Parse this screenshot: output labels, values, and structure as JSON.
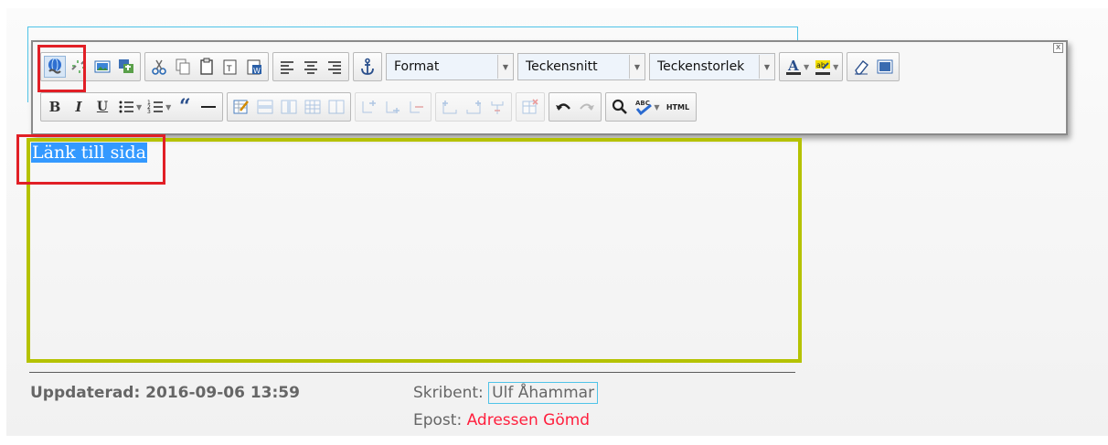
{
  "toolbar": {
    "format_label": "Format",
    "font_label": "Teckensnitt",
    "size_label": "Teckenstorlek",
    "html_label": "HTML",
    "close_label": "x",
    "row1_icons": [
      "insert-link-icon",
      "unlink-icon",
      "insert-image-icon",
      "insert-media-icon",
      "cut-icon",
      "copy-icon",
      "paste-icon",
      "paste-text-icon",
      "paste-word-icon",
      "align-left-icon",
      "align-center-icon",
      "align-right-icon",
      "anchor-icon"
    ],
    "row2_icons": [
      "bold-icon",
      "italic-icon",
      "underline-icon",
      "bullet-list-icon",
      "numbered-list-icon",
      "blockquote-icon",
      "horizontal-rule-icon",
      "edit-table-icon",
      "table-row-icon",
      "table-col-icon",
      "table-cells-icon",
      "table-merge-icon",
      "insert-row-before-icon",
      "insert-row-after-icon",
      "delete-row-icon",
      "insert-col-before-icon",
      "insert-col-after-icon",
      "delete-col-icon",
      "delete-table-icon",
      "undo-icon",
      "redo-icon",
      "search-icon",
      "spellcheck-icon"
    ]
  },
  "editor": {
    "content": "Länk till sida"
  },
  "footer": {
    "updated": "Uppdaterad: 2016-09-06 13:59",
    "author_label": "Skribent:",
    "author_name": "Ulf Åhammar",
    "email_label": "Epost:",
    "email_value": "Adressen Gömd"
  },
  "colors": {
    "editor_border": "#b5c200",
    "highlight_box": "#e11f26",
    "selection": "#3399ff",
    "email_hidden": "#ff1f3d"
  }
}
